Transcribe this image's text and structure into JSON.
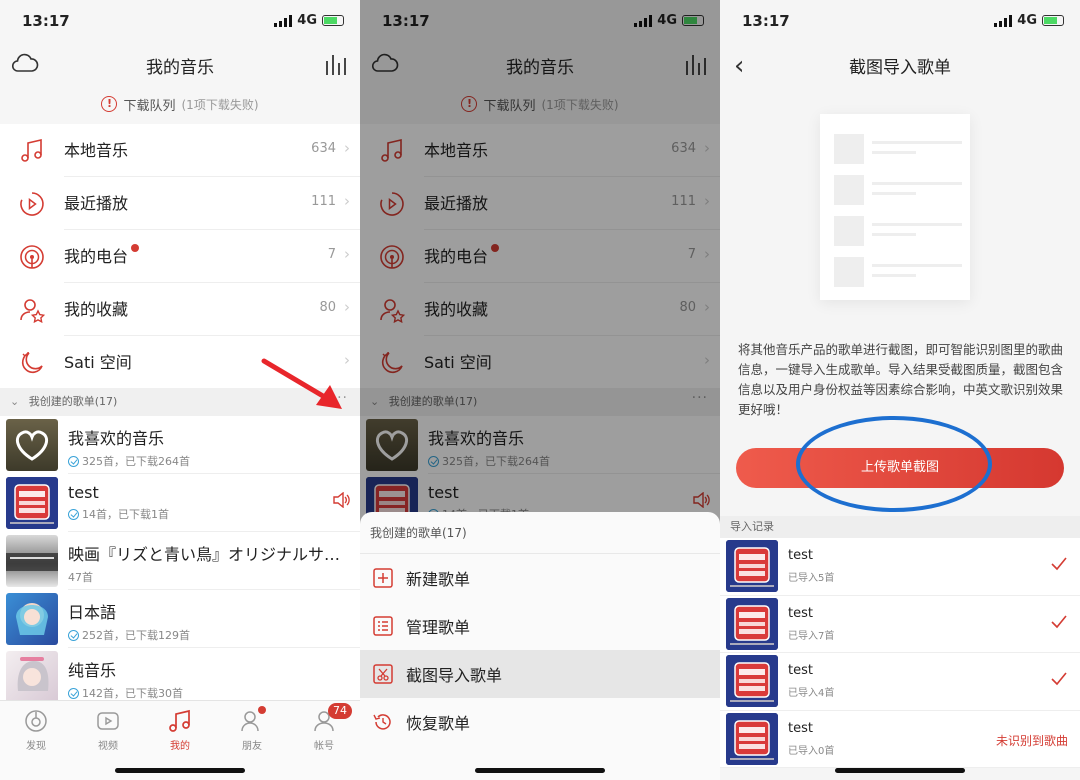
{
  "status": {
    "time": "13:17",
    "network": "4G"
  },
  "screen1": {
    "title": "我的音乐",
    "download_queue": {
      "label": "下载队列",
      "detail": "(1项下载失败)"
    },
    "menu": [
      {
        "label": "本地音乐",
        "count": "634",
        "icon": "music-note-icon"
      },
      {
        "label": "最近播放",
        "count": "111",
        "icon": "recent-play-icon"
      },
      {
        "label": "我的电台",
        "count": "7",
        "icon": "radio-icon"
      },
      {
        "label": "我的收藏",
        "count": "80",
        "icon": "user-star-icon"
      },
      {
        "label": "Sati 空间",
        "count": "",
        "icon": "moon-icon"
      }
    ],
    "section_title": "我创建的歌单(17)",
    "section_more": "···",
    "playlists": [
      {
        "title": "我喜欢的音乐",
        "meta": "325首，已下载264首",
        "cover": "heart"
      },
      {
        "title": "test",
        "meta": "14首，已下载1首",
        "cover": "ralph"
      },
      {
        "title": "映画『リズと青い鳥』オリジナルサ…",
        "meta": "47首",
        "cover": "film"
      },
      {
        "title": "日本語",
        "meta": "252首，已下载129首",
        "cover": "anime1"
      },
      {
        "title": "纯音乐",
        "meta": "142首，已下载30首",
        "cover": "anime2"
      }
    ],
    "tabs": [
      {
        "label": "发现",
        "icon": "discover-icon"
      },
      {
        "label": "视频",
        "icon": "video-icon"
      },
      {
        "label": "我的",
        "icon": "music-icon"
      },
      {
        "label": "朋友",
        "icon": "friends-icon"
      },
      {
        "label": "帐号",
        "icon": "account-icon",
        "badge": "74"
      }
    ]
  },
  "sheet": {
    "title": "我创建的歌单(17)",
    "items": [
      {
        "label": "新建歌单",
        "icon": "plus-square-icon"
      },
      {
        "label": "管理歌单",
        "icon": "list-icon"
      },
      {
        "label": "截图导入歌单",
        "icon": "screenshot-import-icon"
      },
      {
        "label": "恢复歌单",
        "icon": "restore-icon"
      }
    ]
  },
  "screen3": {
    "title": "截图导入歌单",
    "description": "将其他音乐产品的歌单进行截图，即可智能识别图里的歌曲信息，一键导入生成歌单。导入结果受截图质量，截图包含信息以及用户身份权益等因素综合影响，中英文歌识别效果更好哦！",
    "upload_button": "上传歌单截图",
    "records_title": "导入记录",
    "records": [
      {
        "title": "test",
        "meta": "已导入5首",
        "status": "check"
      },
      {
        "title": "test",
        "meta": "已导入7首",
        "status": "check"
      },
      {
        "title": "test",
        "meta": "已导入4首",
        "status": "check"
      },
      {
        "title": "test",
        "meta": "已导入0首",
        "status": "未识别到歌曲"
      }
    ]
  },
  "colors": {
    "accent": "#d43c33",
    "annotation_arrow": "#e8262b",
    "annotation_circle": "#1d6fd0"
  }
}
